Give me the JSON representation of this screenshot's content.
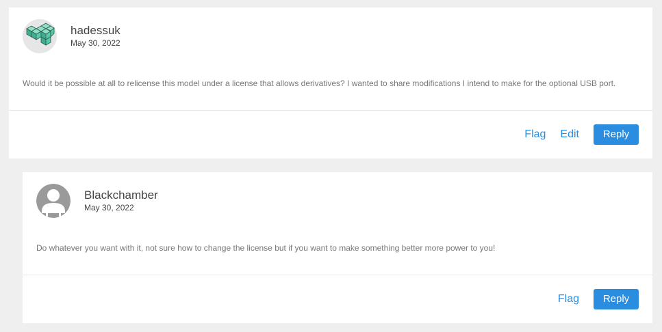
{
  "comments": [
    {
      "author": "hadessuk",
      "date": "May 30, 2022",
      "avatar_icon": "isometric-blocks-icon",
      "body": "Would it be possible at all to relicense this model under a license that allows derivatives? I wanted to share modifications I intend to make for the optional USB port.",
      "actions": {
        "flag": "Flag",
        "edit": "Edit",
        "reply": "Reply"
      }
    },
    {
      "author": "Blackchamber",
      "date": "May 30, 2022",
      "avatar_icon": "default-user-icon",
      "body": "Do whatever you want with it, not sure how to change the license but if you want to make something better more power to you!",
      "actions": {
        "flag": "Flag",
        "reply": "Reply"
      }
    }
  ],
  "colors": {
    "background": "#efefef",
    "card": "#ffffff",
    "accent": "#2b8de0",
    "avatar_teal": "#58c9a6",
    "avatar_gray": "#9a9a9a"
  }
}
